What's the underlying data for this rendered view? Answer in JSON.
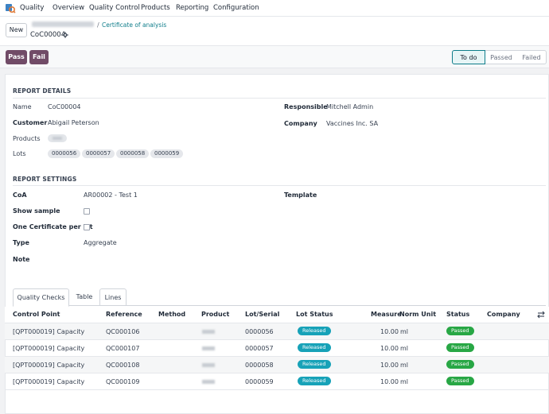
{
  "nav": {
    "app": "Quality",
    "menu": [
      "Overview",
      "Quality Control",
      "Products",
      "Reporting",
      "Configuration"
    ]
  },
  "breadcrumb": {
    "new_label": "New",
    "current": "Certificate of analysis",
    "record": "CoC00004"
  },
  "actions": {
    "pass_label": "Pass",
    "fail_label": "Fail",
    "statuses": [
      "To do",
      "Passed",
      "Failed"
    ],
    "active_status": "To do"
  },
  "report_details": {
    "title": "REPORT DETAILS",
    "name_label": "Name",
    "name_value": "CoC00004",
    "customer_label": "Customer",
    "customer_value": "Abigail Peterson",
    "products_label": "Products",
    "lots_label": "Lots",
    "lots": [
      "0000056",
      "0000057",
      "0000058",
      "0000059"
    ],
    "responsible_label": "Responsible",
    "responsible_value": "Mitchell Admin",
    "company_label": "Company",
    "company_value": "Vaccines Inc. SA"
  },
  "report_settings": {
    "title": "REPORT SETTINGS",
    "coa_label": "CoA",
    "coa_value": "AR00002 - Test 1",
    "template_label": "Template",
    "show_sample_label": "Show sample",
    "one_cert_label": "One Certificate per lot",
    "type_label": "Type",
    "type_value": "Aggregate",
    "note_label": "Note"
  },
  "tabs": [
    "Quality Checks",
    "Table",
    "Lines"
  ],
  "table": {
    "headers": [
      "Control Point",
      "Reference",
      "Method",
      "Product",
      "Lot/Serial",
      "Lot Status",
      "Measure",
      "Norm Unit",
      "Status",
      "Company"
    ],
    "rows": [
      {
        "control_point": "[QPT000019] Capacity",
        "reference": "QC000106",
        "lot": "0000056",
        "lot_status": "Released",
        "measure": "10.00",
        "unit": "ml",
        "status": "Passed"
      },
      {
        "control_point": "[QPT000019] Capacity",
        "reference": "QC000107",
        "lot": "0000057",
        "lot_status": "Released",
        "measure": "10.00",
        "unit": "ml",
        "status": "Passed"
      },
      {
        "control_point": "[QPT000019] Capacity",
        "reference": "QC000108",
        "lot": "0000058",
        "lot_status": "Released",
        "measure": "10.00",
        "unit": "ml",
        "status": "Passed"
      },
      {
        "control_point": "[QPT000019] Capacity",
        "reference": "QC000109",
        "lot": "0000059",
        "lot_status": "Released",
        "measure": "10.00",
        "unit": "ml",
        "status": "Passed"
      }
    ]
  },
  "colors": {
    "brand": "#714b67",
    "accent": "#0e7d8a",
    "released": "#17a2b8",
    "passed": "#28a745"
  }
}
